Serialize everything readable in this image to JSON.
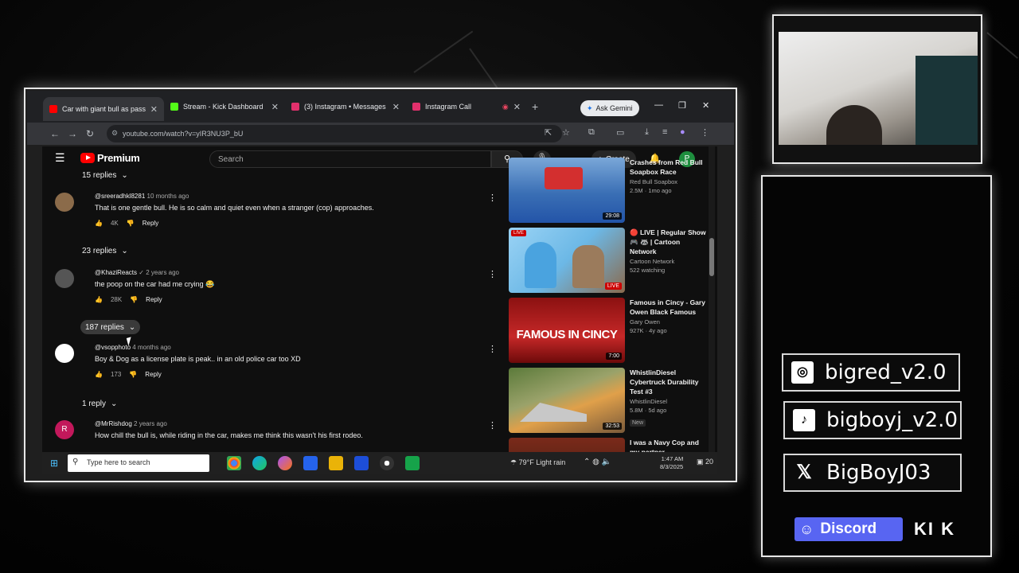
{
  "browser": {
    "tabs": [
      {
        "title": "Car with giant bull as passeng",
        "color": "#ff0000"
      },
      {
        "title": "Stream - Kick Dashboard",
        "color": "#53fc18"
      },
      {
        "title": "(3) Instagram • Messages",
        "color": "#e1306c"
      },
      {
        "title": "Instagram Call",
        "color": "#e1306c"
      }
    ],
    "ask_gemini": "Ask Gemini",
    "url": "youtube.com/watch?v=yIR3NU3P_bU"
  },
  "youtube": {
    "logo_text": "Premium",
    "search_placeholder": "Search",
    "create_label": "Create",
    "avatar_letter": "P"
  },
  "comments": {
    "top_replies": "15 replies",
    "items": [
      {
        "author": "@sreeradhkl8281",
        "ago": "10 months ago",
        "text": "That is one gentle bull. He is so calm and quiet even when a stranger (cop) approaches.",
        "likes": "4K",
        "reply": "Reply",
        "replies": "23 replies"
      },
      {
        "author": "@KhaziReacts",
        "ago": "2 years ago",
        "text": "the poop on the car had me crying 😂",
        "likes": "28K",
        "reply": "Reply",
        "replies": "187 replies"
      },
      {
        "author": "@vsopphoto",
        "ago": "4 months ago",
        "text": "Boy & Dog as a license plate is peak.. in an old police car too XD",
        "likes": "173",
        "reply": "Reply",
        "replies": "1 reply"
      },
      {
        "author": "@MrRishdog",
        "ago": "2 years ago",
        "text": "How chill the bull is, while riding in the car, makes me think this wasn't his first rodeo.",
        "avatar_letter": "R"
      }
    ]
  },
  "sidebar": {
    "videos": [
      {
        "title": "Crashes from Red Bull Soapbox Race",
        "channel": "Red Bull Soapbox",
        "meta": "2.5M · 1mo ago",
        "duration": "29:08"
      },
      {
        "title": "🔴 LIVE | Regular Show 🎮 🦝 | Cartoon Network",
        "channel": "Cartoon Network",
        "meta": "522 watching",
        "live": "LIVE",
        "live_top": "LIVE"
      },
      {
        "title": "Famous in Cincy - Gary Owen Black Famous",
        "channel": "Gary Owen",
        "meta": "927K · 4y ago",
        "duration": "7:00",
        "overlay": "FAMOUS IN CINCY"
      },
      {
        "title": "WhistlinDiesel Cybertruck Durability Test #3",
        "channel": "WhistlinDiesel",
        "meta": "5.8M · 5d ago",
        "duration": "32:53",
        "badge": "New"
      },
      {
        "title": "I was a Navy Cop and my partner..."
      }
    ]
  },
  "taskbar": {
    "search_placeholder": "Type here to search",
    "weather": "79°F  Light rain",
    "time": "1:47 AM",
    "date": "8/3/2025",
    "notif": "20"
  },
  "socials": [
    {
      "icon": "instagram-icon",
      "handle": "bigred_v2.0"
    },
    {
      "icon": "tiktok-icon",
      "handle": "bigboyj_v2.0"
    },
    {
      "icon": "x-icon",
      "handle": "BigBoyJ03"
    }
  ],
  "discord_label": "Discord",
  "kick_label": "KI K"
}
